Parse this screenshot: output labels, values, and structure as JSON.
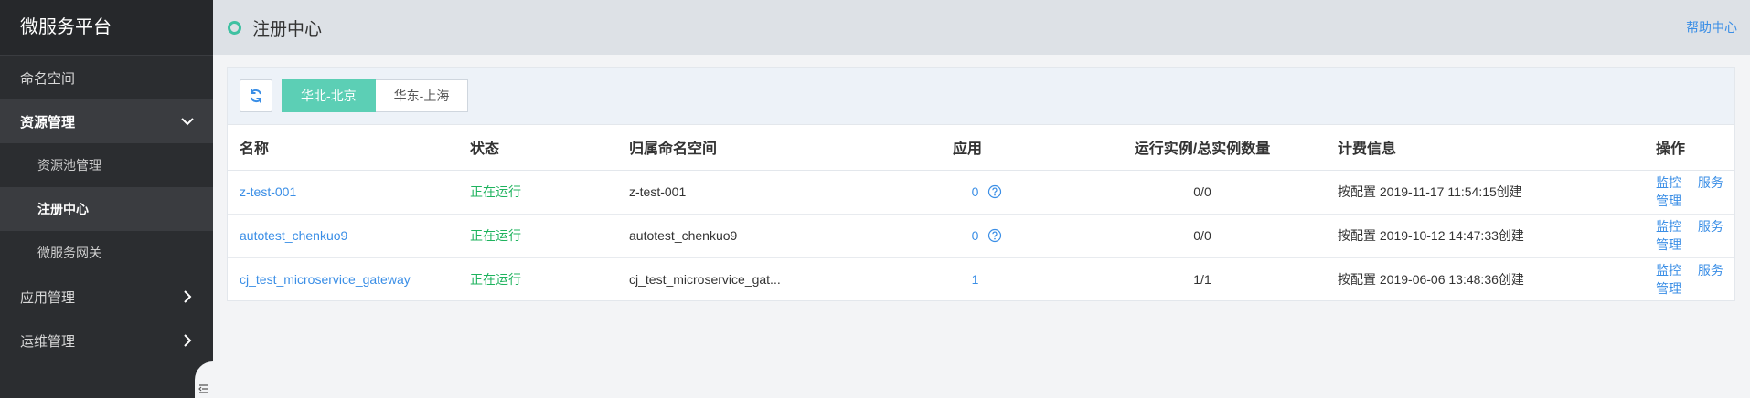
{
  "sidebar": {
    "brand": "微服务平台",
    "items": [
      {
        "label": "命名空间"
      },
      {
        "label": "资源管理"
      },
      {
        "label": "应用管理"
      },
      {
        "label": "运维管理"
      }
    ],
    "sub_items": [
      {
        "label": "资源池管理"
      },
      {
        "label": "注册中心"
      },
      {
        "label": "微服务网关"
      }
    ]
  },
  "header": {
    "title": "注册中心",
    "help": "帮助中心"
  },
  "toolbar": {
    "regions": [
      "华北-北京",
      "华东-上海"
    ],
    "active_region": "华北-北京"
  },
  "table": {
    "columns": [
      "名称",
      "状态",
      "归属命名空间",
      "应用",
      "运行实例/总实例数量",
      "计费信息",
      "操作"
    ],
    "rows": [
      {
        "name": "z-test-001",
        "status": "正在运行",
        "namespace": "z-test-001",
        "apps": "0",
        "instances": "0/0",
        "billing": "按配置 2019-11-17 11:54:15创建",
        "op1": "监控",
        "op2": "服务管理"
      },
      {
        "name": "autotest_chenkuo9",
        "status": "正在运行",
        "namespace": "autotest_chenkuo9",
        "apps": "0",
        "instances": "0/0",
        "billing": "按配置 2019-10-12 14:47:33创建",
        "op1": "监控",
        "op2": "服务管理"
      },
      {
        "name": "cj_test_microservice_gateway",
        "status": "正在运行",
        "namespace": "cj_test_microservice_gat...",
        "apps": "1",
        "instances": "1/1",
        "billing": "按配置 2019-06-06 13:48:36创建",
        "op1": "监控",
        "op2": "服务管理"
      }
    ]
  },
  "colors": {
    "accent": "#5ccfb5",
    "link": "#3a8ee6",
    "running": "#1fb35e",
    "sidebar_bg": "#2b2d30"
  }
}
